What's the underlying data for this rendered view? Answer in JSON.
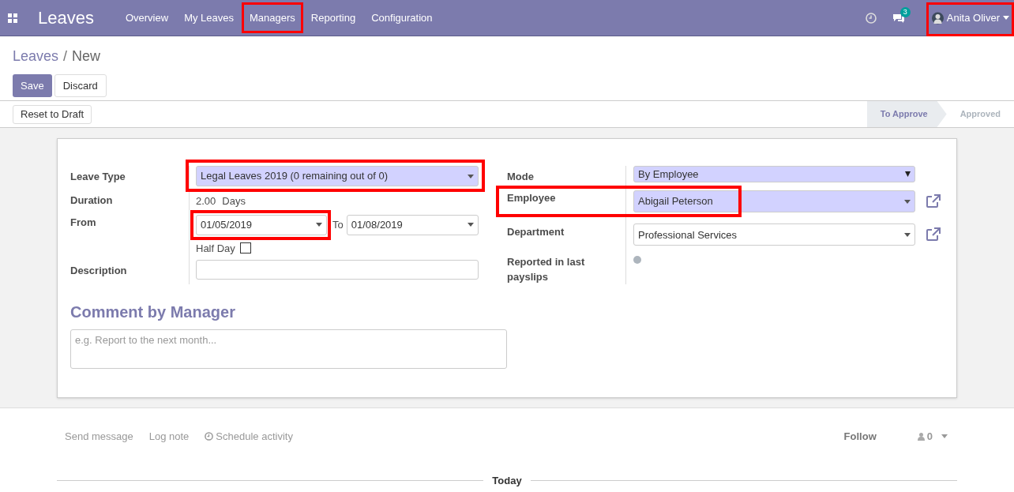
{
  "app_title": "Leaves",
  "nav": [
    {
      "label": "Overview",
      "highlighted": false
    },
    {
      "label": "My Leaves",
      "highlighted": false
    },
    {
      "label": "Managers",
      "highlighted": true
    },
    {
      "label": "Reporting",
      "highlighted": false
    },
    {
      "label": "Configuration",
      "highlighted": false
    }
  ],
  "messages_badge": "3",
  "user": {
    "name": "Anita Oliver",
    "highlighted": true
  },
  "breadcrumb": {
    "parent": "Leaves",
    "separator": "/",
    "current": "New"
  },
  "buttons": {
    "save": "Save",
    "discard": "Discard",
    "reset": "Reset to Draft"
  },
  "status_steps": [
    {
      "label": "To Approve",
      "selected": true
    },
    {
      "label": "Approved",
      "selected": false
    }
  ],
  "left_fields": {
    "leave_type": {
      "label": "Leave Type",
      "value": "Legal Leaves 2019 (0 remaining out of 0)",
      "highlighted": true
    },
    "duration": {
      "label": "Duration",
      "value": "2.00",
      "unit": "Days"
    },
    "from": {
      "label": "From",
      "value": "01/05/2019",
      "highlighted": true,
      "to_label": "To",
      "to_value": "01/08/2019"
    },
    "half_day": {
      "label": "Half Day",
      "checked": false
    },
    "description": {
      "label": "Description"
    }
  },
  "right_fields": {
    "mode": {
      "label": "Mode",
      "value": "By Employee"
    },
    "employee": {
      "label": "Employee",
      "value": "Abigail Peterson",
      "highlighted": true
    },
    "department": {
      "label": "Department",
      "value": "Professional Services"
    },
    "reported": {
      "label": "Reported in last payslips",
      "on": false
    }
  },
  "comment": {
    "title": "Comment by Manager",
    "placeholder": "e.g. Report to the next month..."
  },
  "chatter": {
    "send_message": "Send message",
    "log_note": "Log note",
    "schedule": "Schedule activity",
    "follow": "Follow",
    "followers": "0",
    "today": "Today"
  }
}
